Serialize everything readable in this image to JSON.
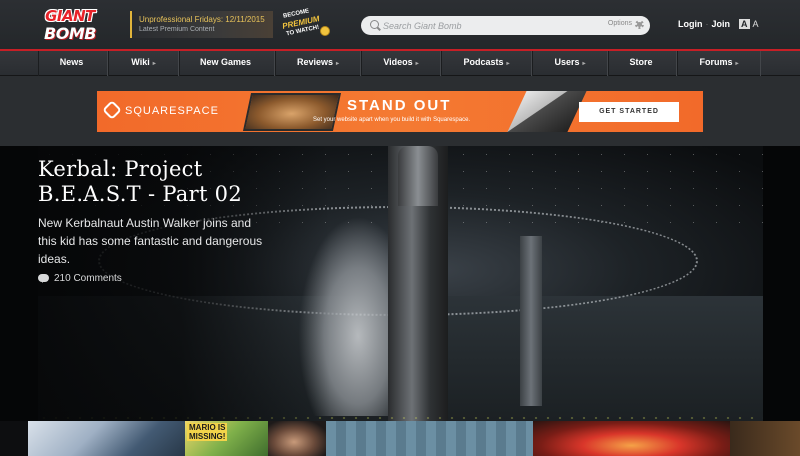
{
  "header": {
    "logo_line1": "GIANT",
    "logo_line2": "BOMB",
    "promo_title": "Unprofessional Fridays: 12/11/2015",
    "promo_subtitle": "Latest Premium Content",
    "premium_line1": "BECOME",
    "premium_line2": "PREMIUM",
    "premium_line3": "TO WATCH!",
    "search_placeholder": "Search Giant Bomb",
    "search_options": "Options",
    "login": "Login",
    "join": "Join",
    "font_size_large": "A",
    "font_size_small": "A"
  },
  "nav": {
    "items": [
      {
        "label": "News",
        "caret": ""
      },
      {
        "label": "Wiki",
        "caret": "▸"
      },
      {
        "label": "New Games",
        "caret": ""
      },
      {
        "label": "Reviews",
        "caret": "▸"
      },
      {
        "label": "Videos",
        "caret": "▸"
      },
      {
        "label": "Podcasts",
        "caret": "▸"
      },
      {
        "label": "Users",
        "caret": "▸"
      },
      {
        "label": "Store",
        "caret": ""
      },
      {
        "label": "Forums",
        "caret": "▸"
      }
    ]
  },
  "ad": {
    "brand": "SQUARESPACE",
    "headline": "STAND OUT",
    "subline": "Set your website apart when you build it with Squarespace.",
    "cta": "GET STARTED",
    "brand_color": "#f26a2a"
  },
  "hero": {
    "title": "Kerbal: Project B.E.A.S.T - Part 02",
    "description": "New Kerbalnaut Austin Walker joins and this kid has some fantastic and dangerous ideas.",
    "comments": "210 Comments"
  },
  "thumbnails": {
    "mario_line1": "MARIO IS",
    "mario_line2": "MISSING!"
  },
  "colors": {
    "accent_red": "#c71f26",
    "promo_gold": "#e7c25a"
  }
}
